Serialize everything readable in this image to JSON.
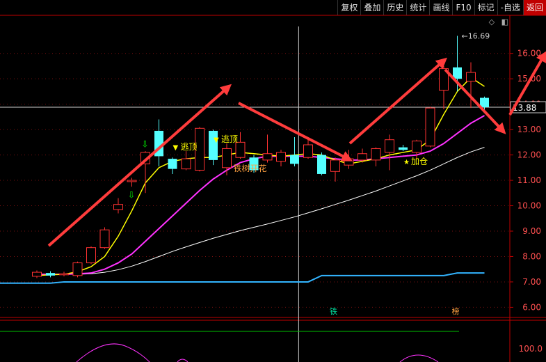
{
  "toolbar": {
    "items": [
      {
        "label": "复权"
      },
      {
        "label": "叠加"
      },
      {
        "label": "历史"
      },
      {
        "label": "统计"
      },
      {
        "label": "画线"
      },
      {
        "label": "F10"
      },
      {
        "label": "标记"
      },
      {
        "label": "-自选"
      },
      {
        "label": "返回"
      }
    ]
  },
  "colors": {
    "up": "#ff3232",
    "down": "#54ffff",
    "ma_short": "#ffff00",
    "ma_mid": "#ff32ff",
    "ma_long": "#ffffff",
    "line_low": "#32b4ff",
    "arrow": "#ff3c3c",
    "grid": "#7a1010",
    "axis_text": "#ff5050"
  },
  "chart_data": {
    "type": "candlestick",
    "y_axis": {
      "ticks": [
        "6.00",
        "7.00",
        "8.00",
        "9.00",
        "10.00",
        "11.00",
        "12.00",
        "13.00",
        "14.00",
        "15.00",
        "16.00"
      ],
      "range": [
        5.6,
        17.5
      ]
    },
    "current_price": "13.88",
    "max_label": "16.69",
    "candles": [
      {
        "o": 7.22,
        "c": 7.38,
        "h": 7.45,
        "l": 7.15
      },
      {
        "o": 7.35,
        "c": 7.25,
        "h": 7.42,
        "l": 7.18
      },
      {
        "o": 7.28,
        "c": 7.32,
        "h": 7.4,
        "l": 7.22
      },
      {
        "o": 7.25,
        "c": 7.75,
        "h": 7.8,
        "l": 7.18
      },
      {
        "o": 7.75,
        "c": 8.35,
        "h": 8.4,
        "l": 7.7
      },
      {
        "o": 8.35,
        "c": 9.05,
        "h": 9.15,
        "l": 8.3
      },
      {
        "o": 9.85,
        "c": 10.05,
        "h": 10.3,
        "l": 9.7
      },
      {
        "o": 10.95,
        "c": 11.0,
        "h": 11.1,
        "l": 10.75
      },
      {
        "o": 11.65,
        "c": 12.1,
        "h": 12.15,
        "l": 10.5
      },
      {
        "o": 12.95,
        "c": 11.95,
        "h": 13.4,
        "l": 11.55
      },
      {
        "o": 11.85,
        "c": 11.45,
        "h": 11.9,
        "l": 11.25
      },
      {
        "o": 11.45,
        "c": 11.85,
        "h": 12.15,
        "l": 11.4
      },
      {
        "o": 11.4,
        "c": 13.05,
        "h": 13.1,
        "l": 11.35
      },
      {
        "o": 12.95,
        "c": 11.8,
        "h": 13.0,
        "l": 11.6
      },
      {
        "o": 11.5,
        "c": 12.25,
        "h": 12.45,
        "l": 11.2
      },
      {
        "o": 11.9,
        "c": 12.5,
        "h": 12.9,
        "l": 11.85
      },
      {
        "o": 11.9,
        "c": 11.4,
        "h": 12.0,
        "l": 11.3
      },
      {
        "o": 11.8,
        "c": 12.05,
        "h": 12.8,
        "l": 11.7
      },
      {
        "o": 11.75,
        "c": 12.1,
        "h": 12.2,
        "l": 11.55
      },
      {
        "o": 12.0,
        "c": 11.65,
        "h": 12.7,
        "l": 11.55
      },
      {
        "o": 11.9,
        "c": 12.4,
        "h": 12.6,
        "l": 11.85
      },
      {
        "o": 12.0,
        "c": 11.25,
        "h": 12.1,
        "l": 11.2
      },
      {
        "o": 11.35,
        "c": 11.8,
        "h": 11.9,
        "l": 10.95
      },
      {
        "o": 11.6,
        "c": 11.85,
        "h": 12.2,
        "l": 11.45
      },
      {
        "o": 11.8,
        "c": 12.05,
        "h": 12.25,
        "l": 11.7
      },
      {
        "o": 11.8,
        "c": 12.25,
        "h": 12.3,
        "l": 11.55
      },
      {
        "o": 12.1,
        "c": 12.6,
        "h": 12.8,
        "l": 11.4
      },
      {
        "o": 12.3,
        "c": 12.2,
        "h": 12.4,
        "l": 12.15
      },
      {
        "o": 12.1,
        "c": 12.55,
        "h": 12.6,
        "l": 11.85
      },
      {
        "o": 12.35,
        "c": 13.85,
        "h": 13.9,
        "l": 12.3
      },
      {
        "o": 14.55,
        "c": 15.4,
        "h": 15.5,
        "l": 13.8
      },
      {
        "o": 15.45,
        "c": 15.0,
        "h": 16.69,
        "l": 14.5
      },
      {
        "o": 14.9,
        "c": 15.25,
        "h": 15.65,
        "l": 13.85
      },
      {
        "o": 14.25,
        "c": 13.88,
        "h": 14.3,
        "l": 13.7
      }
    ],
    "ma_short": [
      7.25,
      7.28,
      7.3,
      7.4,
      7.6,
      8.0,
      8.8,
      9.8,
      10.9,
      11.5,
      11.75,
      11.85,
      11.9,
      11.9,
      12.0,
      12.1,
      12.05,
      12.0,
      11.95,
      12.0,
      12.05,
      12.0,
      11.8,
      11.65,
      11.75,
      11.85,
      12.0,
      12.1,
      12.2,
      12.6,
      13.6,
      14.5,
      15.05,
      14.7
    ],
    "ma_mid": [
      7.3,
      7.3,
      7.3,
      7.32,
      7.35,
      7.5,
      7.75,
      8.1,
      8.6,
      9.1,
      9.6,
      10.1,
      10.6,
      11.05,
      11.4,
      11.7,
      11.85,
      11.95,
      11.95,
      11.95,
      11.95,
      11.9,
      11.85,
      11.8,
      11.8,
      11.85,
      11.9,
      11.95,
      12.0,
      12.15,
      12.45,
      12.85,
      13.25,
      13.55
    ],
    "ma_long": [
      7.3,
      7.3,
      7.3,
      7.3,
      7.32,
      7.38,
      7.48,
      7.62,
      7.8,
      8.0,
      8.2,
      8.38,
      8.55,
      8.72,
      8.87,
      9.02,
      9.15,
      9.28,
      9.42,
      9.56,
      9.72,
      9.88,
      10.05,
      10.22,
      10.4,
      10.58,
      10.78,
      10.98,
      11.18,
      11.4,
      11.65,
      11.9,
      12.12,
      12.3
    ],
    "line_low": [
      6.95,
      6.95,
      7.0,
      7.0,
      7.0,
      7.0,
      7.0,
      7.0,
      7.0,
      7.0,
      7.0,
      7.0,
      7.0,
      7.0,
      7.0,
      7.0,
      7.0,
      7.0,
      7.0,
      7.0,
      7.0,
      7.25,
      7.25,
      7.25,
      7.25,
      7.25,
      7.25,
      7.25,
      7.25,
      7.25,
      7.25,
      7.35,
      7.35,
      7.35
    ],
    "annotations": [
      {
        "text": "逃顶",
        "i": 11,
        "kind": "top"
      },
      {
        "text": "逃顶",
        "i": 14,
        "kind": "top"
      },
      {
        "text": "铁树开花",
        "i": 15,
        "kind": "pattern"
      },
      {
        "text": "加仓",
        "i": 28,
        "kind": "add"
      }
    ],
    "bottom_markers": [
      {
        "text": "铁",
        "i": 22
      },
      {
        "text": "榜",
        "i": 31
      }
    ],
    "sub_panel": {
      "tick": "100.0",
      "line_value": 0.3
    }
  }
}
